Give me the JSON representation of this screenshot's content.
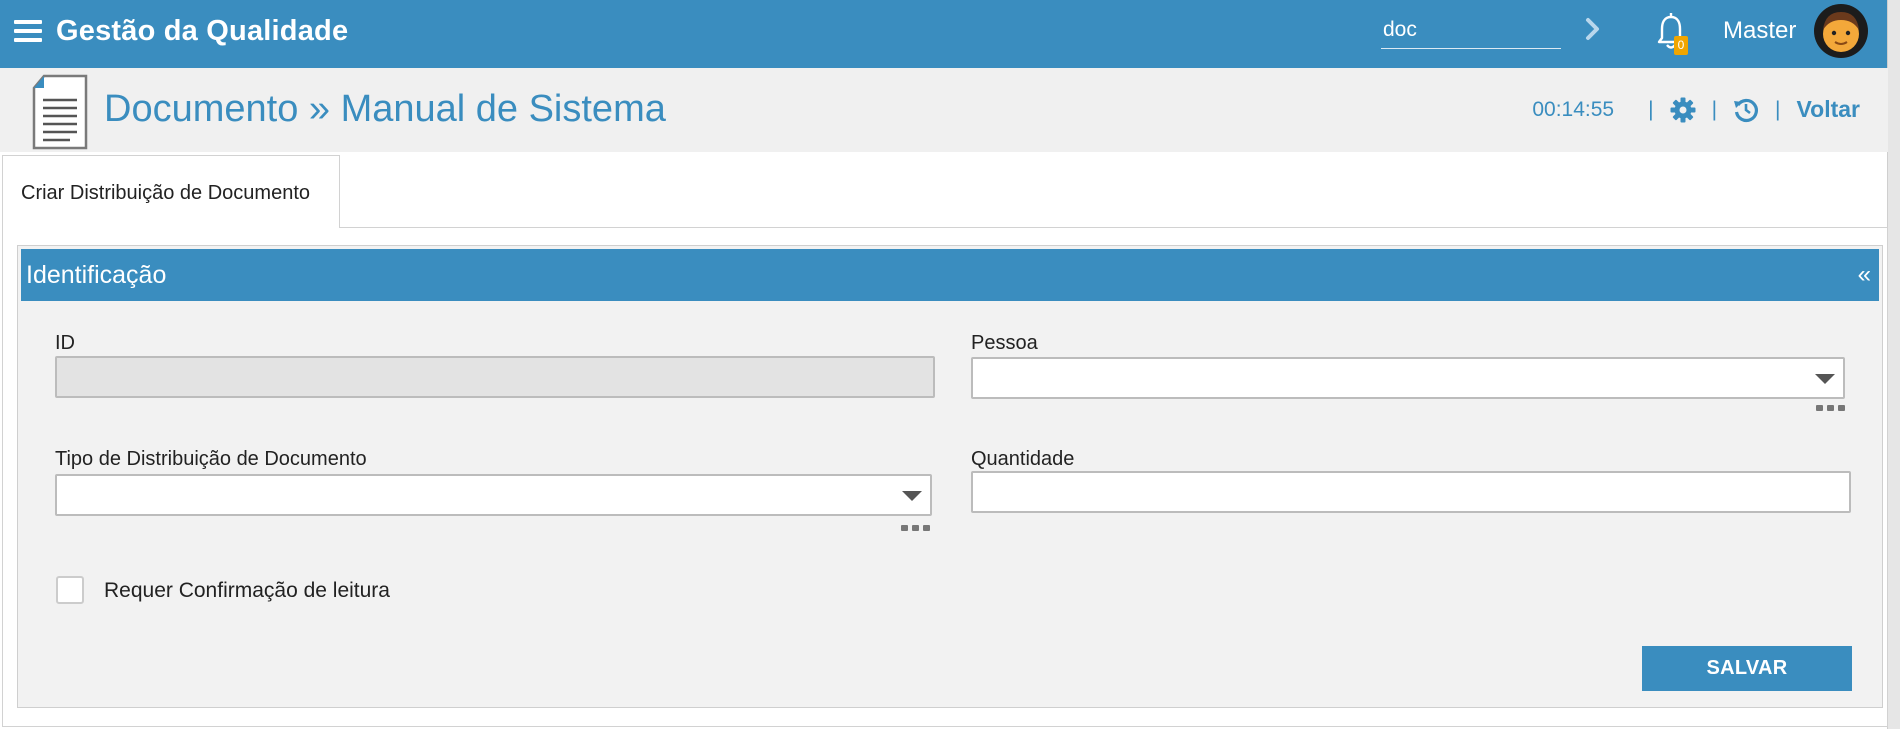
{
  "topbar": {
    "app_title": "Gestão da Qualidade",
    "search_value": "doc",
    "notification_count": "0",
    "user_name": "Master",
    "bar_color": "#3a8dbf",
    "badge_color": "#f0a500"
  },
  "page_header": {
    "title": "Documento » Manual de Sistema",
    "timer": "00:14:55",
    "separator": "|",
    "back_label": "Voltar"
  },
  "tabs": [
    {
      "label": "Criar Distribuição de Documento",
      "active": true
    }
  ],
  "section": {
    "title": "Identificação",
    "collapse_symbol": "«"
  },
  "form": {
    "id_label": "ID",
    "id_value": "",
    "pessoa_label": "Pessoa",
    "pessoa_value": "",
    "tipo_label": "Tipo de Distribuição de Documento",
    "tipo_value": "",
    "quantidade_label": "Quantidade",
    "quantidade_value": "",
    "confirm_label": "Requer Confirmação de leitura",
    "confirm_checked": false,
    "save_label": "SALVAR"
  },
  "icons": {
    "menu": "hamburger-icon",
    "search_go": "chevron-right-icon",
    "notifications": "bell-icon",
    "avatar": "user-avatar-icon",
    "page": "document-icon",
    "settings": "gear-icon",
    "history": "history-icon",
    "select": "caret-down-icon",
    "more": "ellipsis-icon"
  }
}
